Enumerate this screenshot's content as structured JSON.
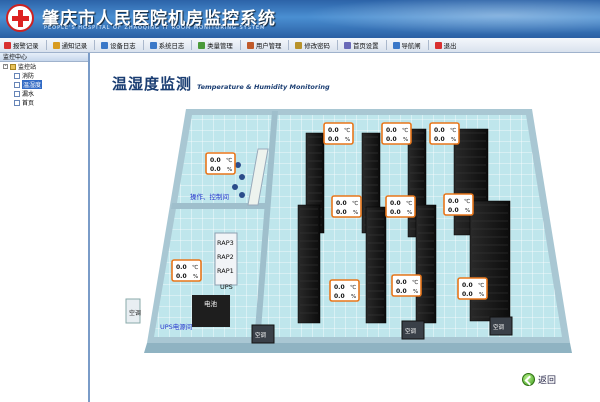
{
  "app": {
    "title": "肇庆市人民医院机房监控系统",
    "subtitle": "PEOPLE'S HOSPITAL OF ZHAOQING IT ROOM MONITORING SYSTEM"
  },
  "toolbar": {
    "items": [
      {
        "label": "报警记录",
        "icon": "alarm-icon",
        "color": "#d83030"
      },
      {
        "label": "通知记录",
        "icon": "notice-icon",
        "color": "#d89b20"
      },
      {
        "label": "设备日志",
        "icon": "device-log-icon",
        "color": "#3a78c8"
      },
      {
        "label": "系统日志",
        "icon": "system-log-icon",
        "color": "#3a78c8"
      },
      {
        "label": "类量管理",
        "icon": "category-icon",
        "color": "#4a9a3a"
      },
      {
        "label": "用户管理",
        "icon": "users-icon",
        "color": "#c05a2a"
      },
      {
        "label": "修改密码",
        "icon": "key-icon",
        "color": "#b8922a"
      },
      {
        "label": "首页设置",
        "icon": "home-settings-icon",
        "color": "#6a6ab8"
      },
      {
        "label": "导航闸",
        "icon": "navigation-icon",
        "color": "#3a78c8"
      },
      {
        "label": "退出",
        "icon": "exit-icon",
        "color": "#d83030"
      }
    ]
  },
  "sidebar": {
    "header": "监控中心",
    "root": "监控站",
    "items": [
      "消防",
      "温湿度",
      "漏水",
      "首页"
    ],
    "selected": "温湿度"
  },
  "main": {
    "title": "温湿度监测",
    "subtitle": "Temperature & Humidity Monitoring",
    "return_label": "返回"
  },
  "sensor_units": {
    "temp": "℃",
    "hum": "%"
  },
  "sensors": [
    {
      "temp": "0.0",
      "hum": "0.0"
    },
    {
      "temp": "0.0",
      "hum": "0.0"
    },
    {
      "temp": "0.0",
      "hum": "0.0"
    },
    {
      "temp": "0.0",
      "hum": "0.0"
    },
    {
      "temp": "0.0",
      "hum": "0.0"
    },
    {
      "temp": "0.0",
      "hum": "0.0"
    },
    {
      "temp": "0.0",
      "hum": "0.0"
    },
    {
      "temp": "0.0",
      "hum": "0.0"
    },
    {
      "temp": "0.0",
      "hum": "0.0"
    },
    {
      "temp": "0.0",
      "hum": "0.0"
    },
    {
      "temp": "0.0",
      "hum": "0.0"
    }
  ],
  "floorplan": {
    "operation_room_label": "操作、控制间",
    "ups_room_label": "UPS电源间",
    "rap_labels": [
      "RAP3",
      "RAP2",
      "RAP1"
    ],
    "ups_label": "UPS",
    "battery_label": "电池",
    "aircon_labels": [
      "空调",
      "空调",
      "空调",
      "空调"
    ]
  },
  "colors": {
    "header_blue": "#2c63a8",
    "floor": "#bfe6ec",
    "wall": "#a9c7d3",
    "rack": "#1b1b1b",
    "sensor_border": "#e8761a",
    "room_label": "#2233cc"
  }
}
